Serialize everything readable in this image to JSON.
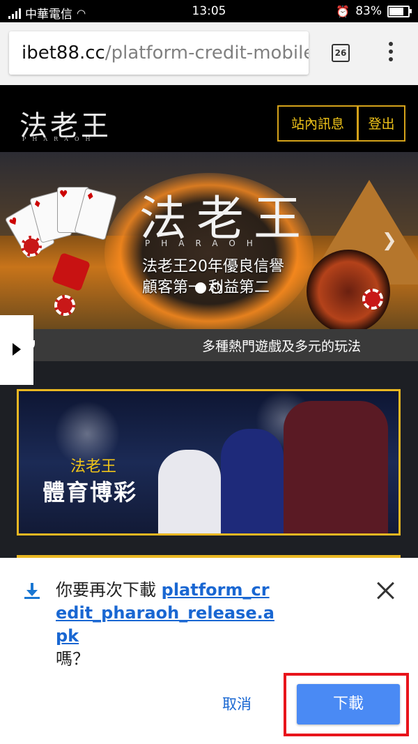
{
  "status_bar": {
    "carrier": "中華電信",
    "time": "13:05",
    "battery": "83%",
    "battery_level": 0.83
  },
  "browser": {
    "url_host": "ibet88.cc",
    "url_path": "/platform-credit-mobile/",
    "tab_count": "26"
  },
  "site": {
    "logo": "法老王",
    "logo_sub": "PHARAOH",
    "nav": {
      "messages_label": "站內訊息",
      "logout_label": "登出"
    },
    "hero": {
      "logo": "法老王",
      "logo_sub": "PHARAOH",
      "slogan_line1": "法老王20年優良信譽",
      "slogan_line2": "顧客第一 利益第二",
      "slides": 2,
      "active_slide": 1
    },
    "marquee_text": "多種熱門遊戲及多元的玩法",
    "sports_banner": {
      "brand": "法老王",
      "title": "體育博彩"
    }
  },
  "download_dialog": {
    "message_prefix": "你要再次下載",
    "filename": "platform_credit_pharaoh_release.apk",
    "message_suffix": "嗎？",
    "cancel_label": "取消",
    "download_label": "下載"
  },
  "colors": {
    "accent_gold": "#e9b722",
    "link_blue": "#1967d2",
    "download_button": "#4a8af4",
    "highlight_red": "#e8141b"
  }
}
